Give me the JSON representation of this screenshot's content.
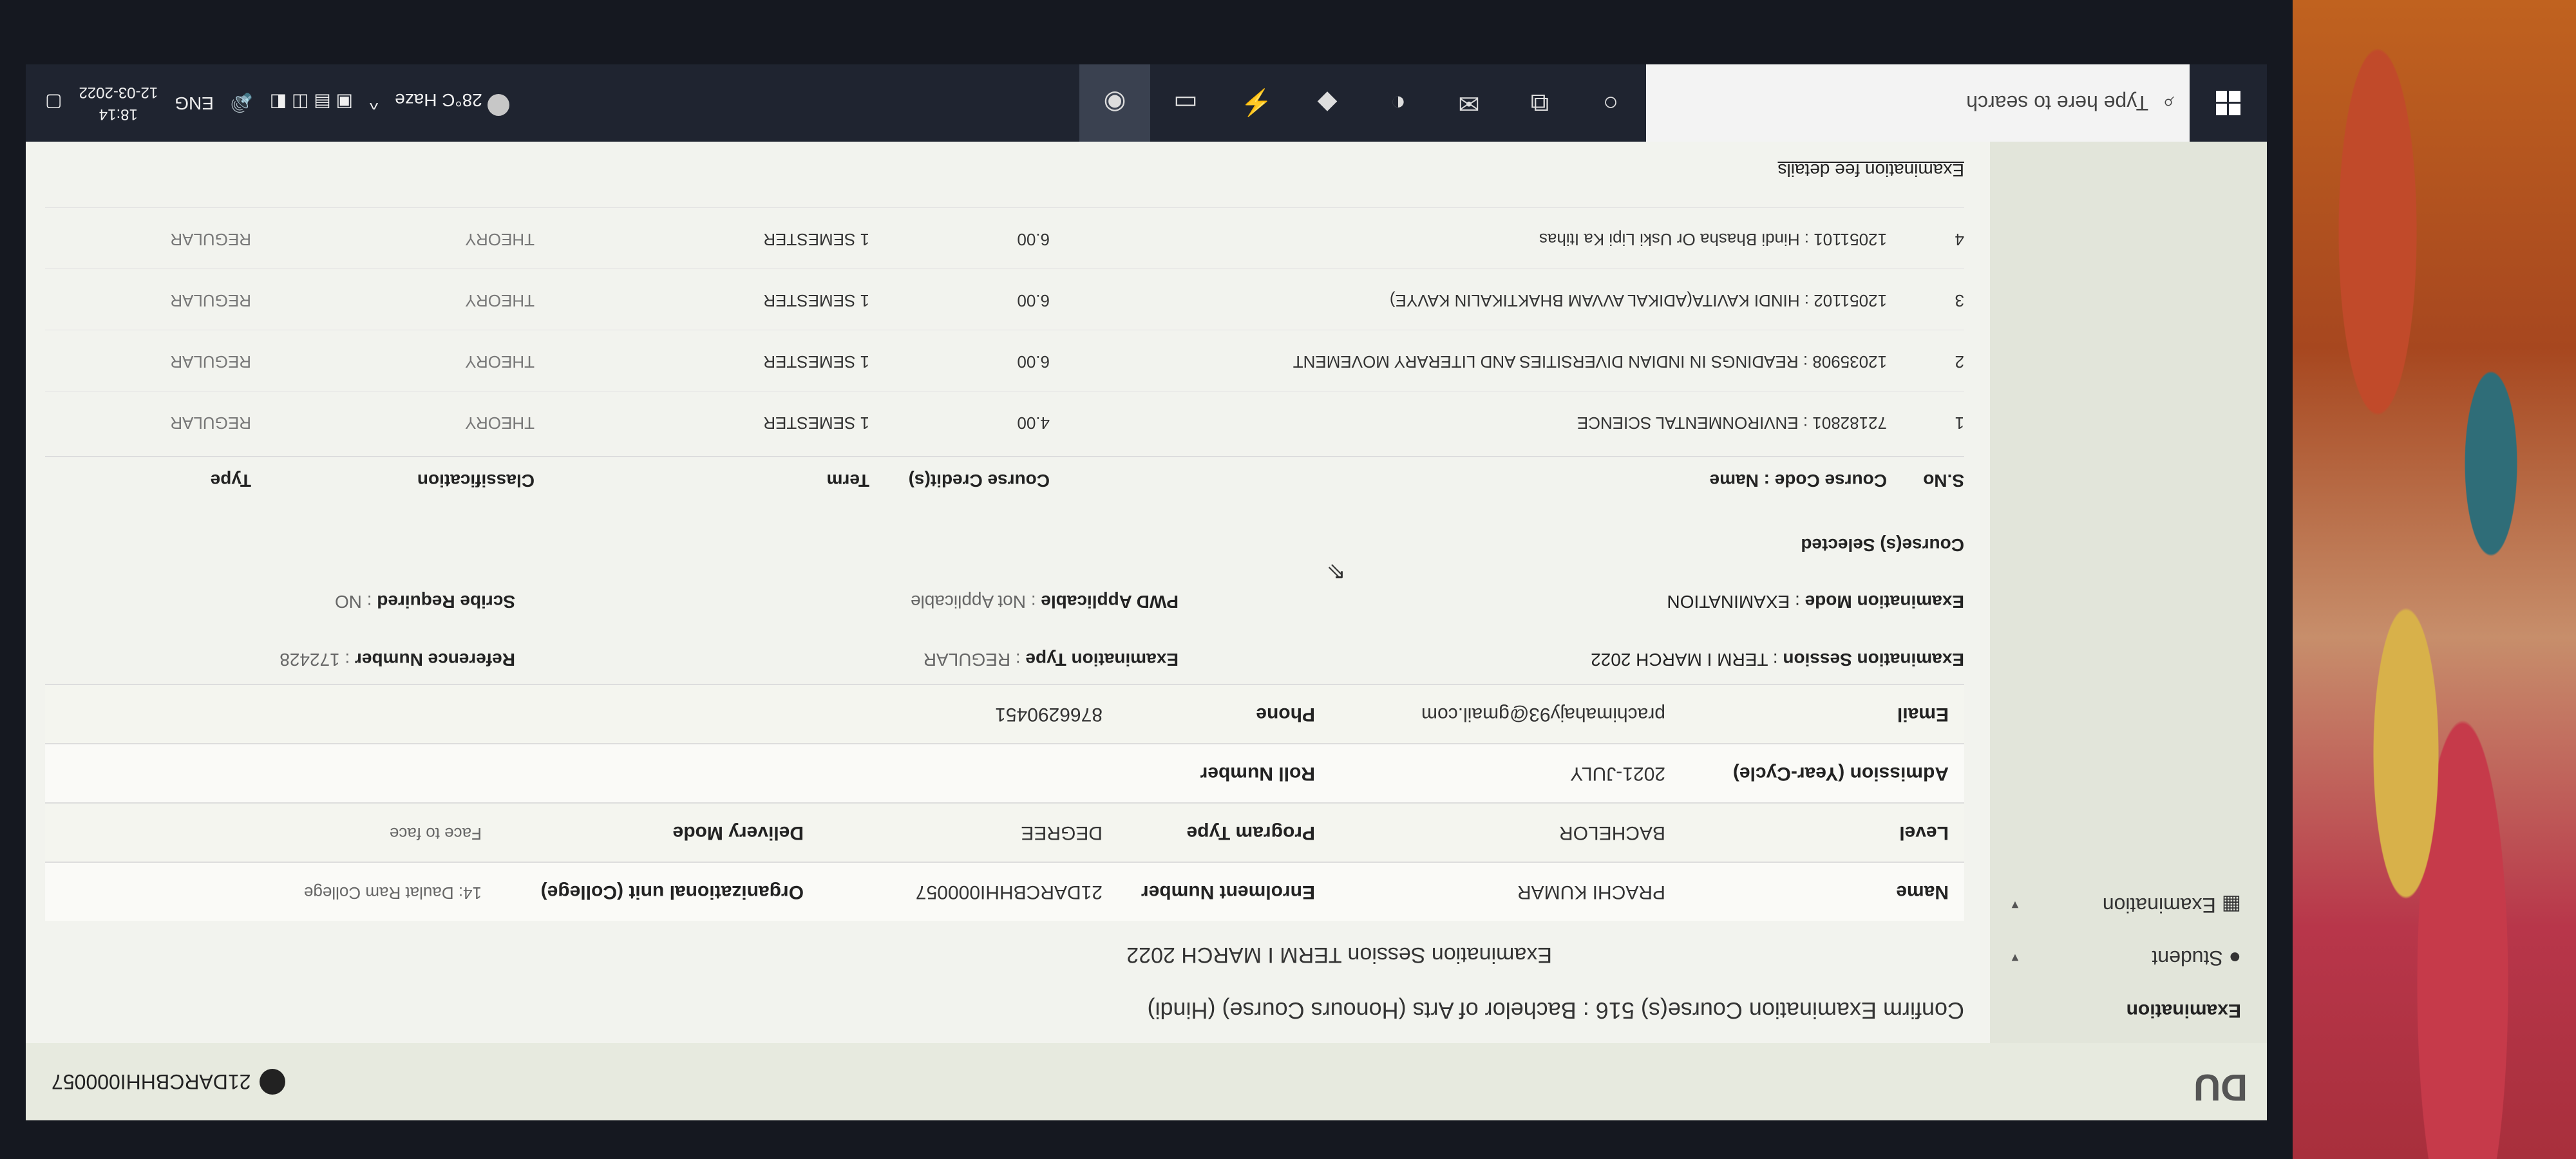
{
  "app": {
    "logo": "DU",
    "user_id": "21DARCBHHI000057"
  },
  "sidebar": {
    "heading": "Examination",
    "items": [
      {
        "label": "Student"
      },
      {
        "label": "Examination"
      }
    ]
  },
  "main": {
    "title": "Confirm Examination Course(s) 516 : Bachelor of Arts (Honours Course) (Hindi)",
    "session_heading": "Examination Session TERM I MARCH 2022",
    "info": {
      "name_label": "Name",
      "name_value": "PRACHI KUMAR",
      "enrol_label": "Enrolment Number",
      "enrol_value": "21DARCBHHI000057",
      "org_label": "Organizational unit (College)",
      "org_value": "14: Daulat Ram College",
      "level_label": "Level",
      "level_value": "BACHELOR",
      "program_label": "Program Type",
      "program_value": "DEGREE",
      "delivery_label": "Delivery Mode",
      "delivery_value": "Face to face",
      "admission_label": "Admission (Year-Cycle)",
      "admission_value": "2021-JULY",
      "roll_label": "Roll Number",
      "roll_value": "",
      "email_label": "Email",
      "email_value": "prachimahajy93@gmail.com",
      "phone_label": "Phone",
      "phone_value": "8766290451"
    },
    "exam": {
      "session_label": "Examination Session",
      "session_value": ": TERM I MARCH 2022",
      "type_label": "Examination Type",
      "type_value": ": REGULAR",
      "ref_label": "Reference Number",
      "ref_value": ": 172428",
      "mode_label": "Examination Mode",
      "mode_value": ": EXAMINATION",
      "pwd_label": "PWD Applicable",
      "pwd_value": ": Not Applicable",
      "scribe_label": "Scribe Required",
      "scribe_value": ": NO"
    },
    "courses_heading": "Course(s) Selected",
    "course_columns": [
      "S.No",
      "Course Code : Name",
      "Course Credit(s)",
      "Term",
      "Classification",
      "Type"
    ],
    "courses": [
      {
        "sno": "1",
        "name": "72182801 : ENVIRONMENTAL SCIENCE",
        "credits": "4.00",
        "term": "1 SEMESTER",
        "classification": "THEORY",
        "type": "REGULAR"
      },
      {
        "sno": "2",
        "name": "12035908 : READINGS IN INDIAN DIVERSITIES AND LITERARY MOVEMENT",
        "credits": "6.00",
        "term": "1 SEMESTER",
        "classification": "THEORY",
        "type": "REGULAR"
      },
      {
        "sno": "3",
        "name": "12051102 : HINDI KAVITA(ADIKAL AVVAM BHAKTIKALIN KAVYE)",
        "credits": "6.00",
        "term": "1 SEMESTER",
        "classification": "THEORY",
        "type": "REGULAR"
      },
      {
        "sno": "4",
        "name": "12051101 : Hindi Bhasha Or Uski Lipi Ka Itihas",
        "credits": "6.00",
        "term": "1 SEMESTER",
        "classification": "THEORY",
        "type": "REGULAR"
      }
    ],
    "footer_link": "Examination fee details"
  },
  "taskbar": {
    "search_placeholder": "Type here to search",
    "weather": "28°C Haze",
    "language": "ENG",
    "time": "18:14",
    "date": "12-03-2022"
  }
}
